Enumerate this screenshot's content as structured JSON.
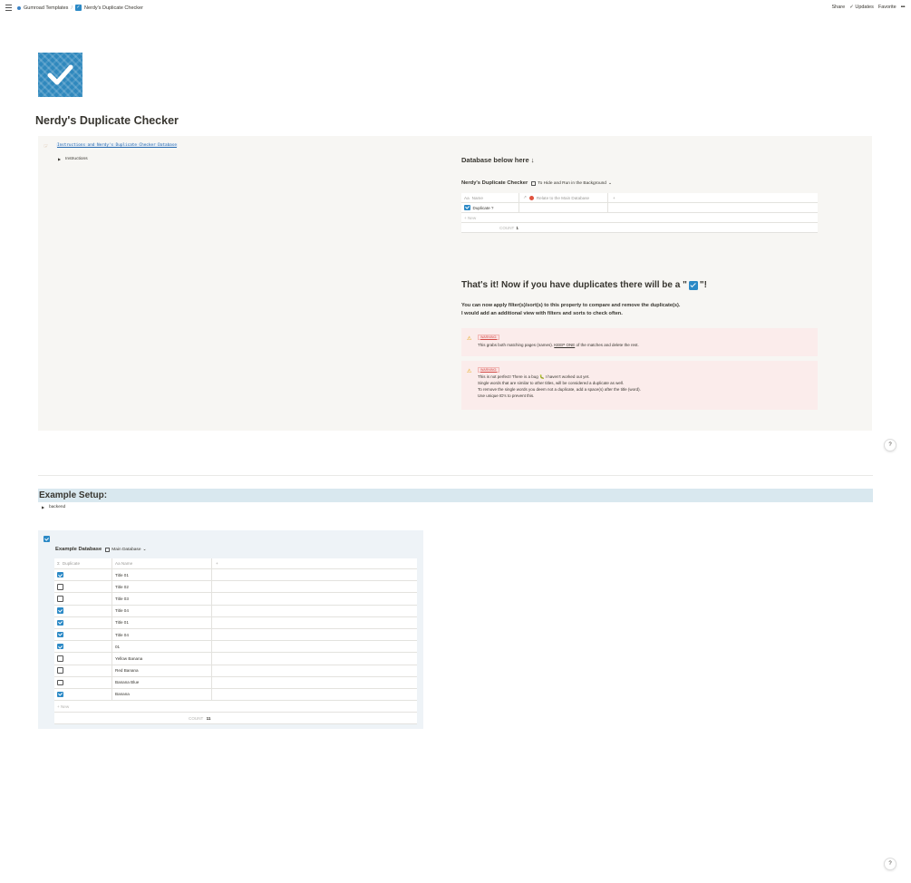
{
  "topbar": {
    "breadcrumb": [
      "Gumroad Templates",
      "/",
      "Nerdy's Duplicate Checker"
    ],
    "share": "Share",
    "updates": "Updates",
    "favorite": "Favorite",
    "more": "•••"
  },
  "page": {
    "title": "Nerdy's Duplicate Checker"
  },
  "callout": {
    "link": "Instructions and Nerdy's Duplicate Checker Database",
    "toggle": "Instructions",
    "heading_db": "Database below here ↓",
    "db_title": "Nerdy's Duplicate Checker",
    "db_view": "To Hide and Run in the Background",
    "table": {
      "headers": [
        "Name",
        "Relate to the Main Database",
        "+"
      ],
      "rows": [
        {
          "checked": true,
          "name": "Duplicate ?"
        }
      ],
      "new_label": "+ New",
      "count_label": "COUNT",
      "count_value": "1"
    },
    "thats_it_pre": "That's it! Now if you have duplicates there will be a \"",
    "thats_it_post": "\"!",
    "para_line1": "You can now apply filter(s)/sort(s) to this property to compare and remove the duplicate(s).",
    "para_line2": "I would add an additional view with filters and sorts to check often.",
    "warning1": {
      "tag": "WARNING:",
      "text_pre": "This grabs both matching pages (names). ",
      "text_keep": "KEEP ONE",
      "text_post": " of the matches and delete the rest."
    },
    "warning2": {
      "tag": "WARNING:",
      "lines": [
        "This is not perfect! There is a bug 🐛 I haven't worked out yet.",
        "Single words that are similar to other titles, will be considered a duplicate as well.",
        "To remove the single words you deem not a duplicate, add a space(s) after the title (word).",
        "Use unique ID's to prevent this."
      ]
    }
  },
  "help_label": "?",
  "example": {
    "heading": "Example Setup:",
    "backend_toggle": "backend",
    "db_title": "Example Database",
    "db_view": "Main Database",
    "headers": [
      "Duplicate",
      "Name",
      "+"
    ],
    "rows": [
      {
        "checked": true,
        "name": "Title 01"
      },
      {
        "checked": false,
        "name": "Title 02"
      },
      {
        "checked": false,
        "name": "Title 03"
      },
      {
        "checked": true,
        "name": "Title 04"
      },
      {
        "checked": true,
        "name": "Title 01"
      },
      {
        "checked": true,
        "name": "Title 04"
      },
      {
        "checked": true,
        "name": "01"
      },
      {
        "checked": false,
        "name": "Yellow Banana"
      },
      {
        "checked": false,
        "name": "Red Banana"
      },
      {
        "checked": false,
        "name": "Banana Blue"
      },
      {
        "checked": true,
        "name": "Banana"
      }
    ],
    "new_label": "+ New",
    "count_label": "COUNT",
    "count_value": "11"
  },
  "colors": {
    "accent": "#2b89c6",
    "callout_bg": "#f7f6f3",
    "warning_bg": "#fbeceb",
    "example_heading_bg": "#d9e8ef",
    "example_callout_bg": "#eef3f7"
  }
}
